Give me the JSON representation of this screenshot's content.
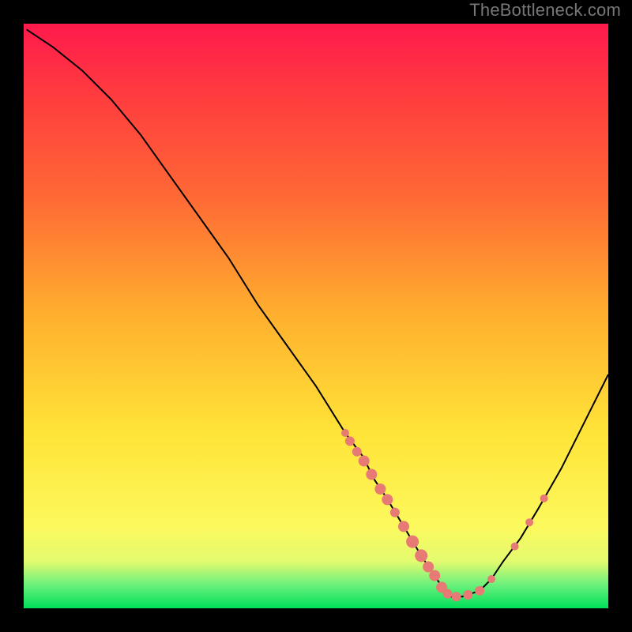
{
  "attribution": "TheBottleneck.com",
  "colors": {
    "dot": "#e77a74",
    "curve": "#000000"
  },
  "chart_data": {
    "type": "line",
    "title": "",
    "xlabel": "",
    "ylabel": "",
    "note": "Bottleneck-percentage style curve. x and y are normalized 0–100 to the plotted square. y=0 is the bottom (green, best); y=100 is top (red, worst). Curve minimum near x≈73.",
    "xlim": [
      0,
      100
    ],
    "ylim": [
      0,
      100
    ],
    "series": [
      {
        "name": "bottleneck-curve",
        "x": [
          0.5,
          5,
          10,
          15,
          20,
          25,
          30,
          35,
          40,
          45,
          50,
          55,
          58,
          60,
          62,
          65,
          68,
          70,
          72,
          73,
          75,
          78,
          80,
          82,
          85,
          88,
          92,
          96,
          100
        ],
        "y": [
          99,
          96,
          92,
          87,
          81,
          74,
          67,
          60,
          52,
          45,
          38,
          30,
          26,
          22,
          19,
          14,
          9,
          6,
          3,
          2,
          2,
          3,
          5,
          8,
          12,
          17,
          24,
          32,
          40
        ]
      }
    ],
    "dots": [
      {
        "x": 55.0,
        "y": 30.0,
        "r": 5
      },
      {
        "x": 55.8,
        "y": 28.6,
        "r": 6
      },
      {
        "x": 57.0,
        "y": 26.8,
        "r": 6
      },
      {
        "x": 58.2,
        "y": 25.2,
        "r": 7
      },
      {
        "x": 59.5,
        "y": 22.9,
        "r": 7
      },
      {
        "x": 61.0,
        "y": 20.4,
        "r": 7
      },
      {
        "x": 62.2,
        "y": 18.6,
        "r": 7
      },
      {
        "x": 63.5,
        "y": 16.4,
        "r": 6
      },
      {
        "x": 65.0,
        "y": 14.0,
        "r": 7
      },
      {
        "x": 66.5,
        "y": 11.4,
        "r": 8
      },
      {
        "x": 68.0,
        "y": 9.0,
        "r": 8
      },
      {
        "x": 69.2,
        "y": 7.1,
        "r": 7
      },
      {
        "x": 70.3,
        "y": 5.6,
        "r": 7
      },
      {
        "x": 71.5,
        "y": 3.6,
        "r": 7
      },
      {
        "x": 72.5,
        "y": 2.5,
        "r": 6
      },
      {
        "x": 74.0,
        "y": 2.0,
        "r": 6
      },
      {
        "x": 76.0,
        "y": 2.3,
        "r": 6
      },
      {
        "x": 78.0,
        "y": 3.0,
        "r": 6
      },
      {
        "x": 80.0,
        "y": 5.0,
        "r": 5
      },
      {
        "x": 84.0,
        "y": 10.6,
        "r": 5
      },
      {
        "x": 86.5,
        "y": 14.7,
        "r": 5
      },
      {
        "x": 89.0,
        "y": 18.8,
        "r": 5
      }
    ]
  }
}
